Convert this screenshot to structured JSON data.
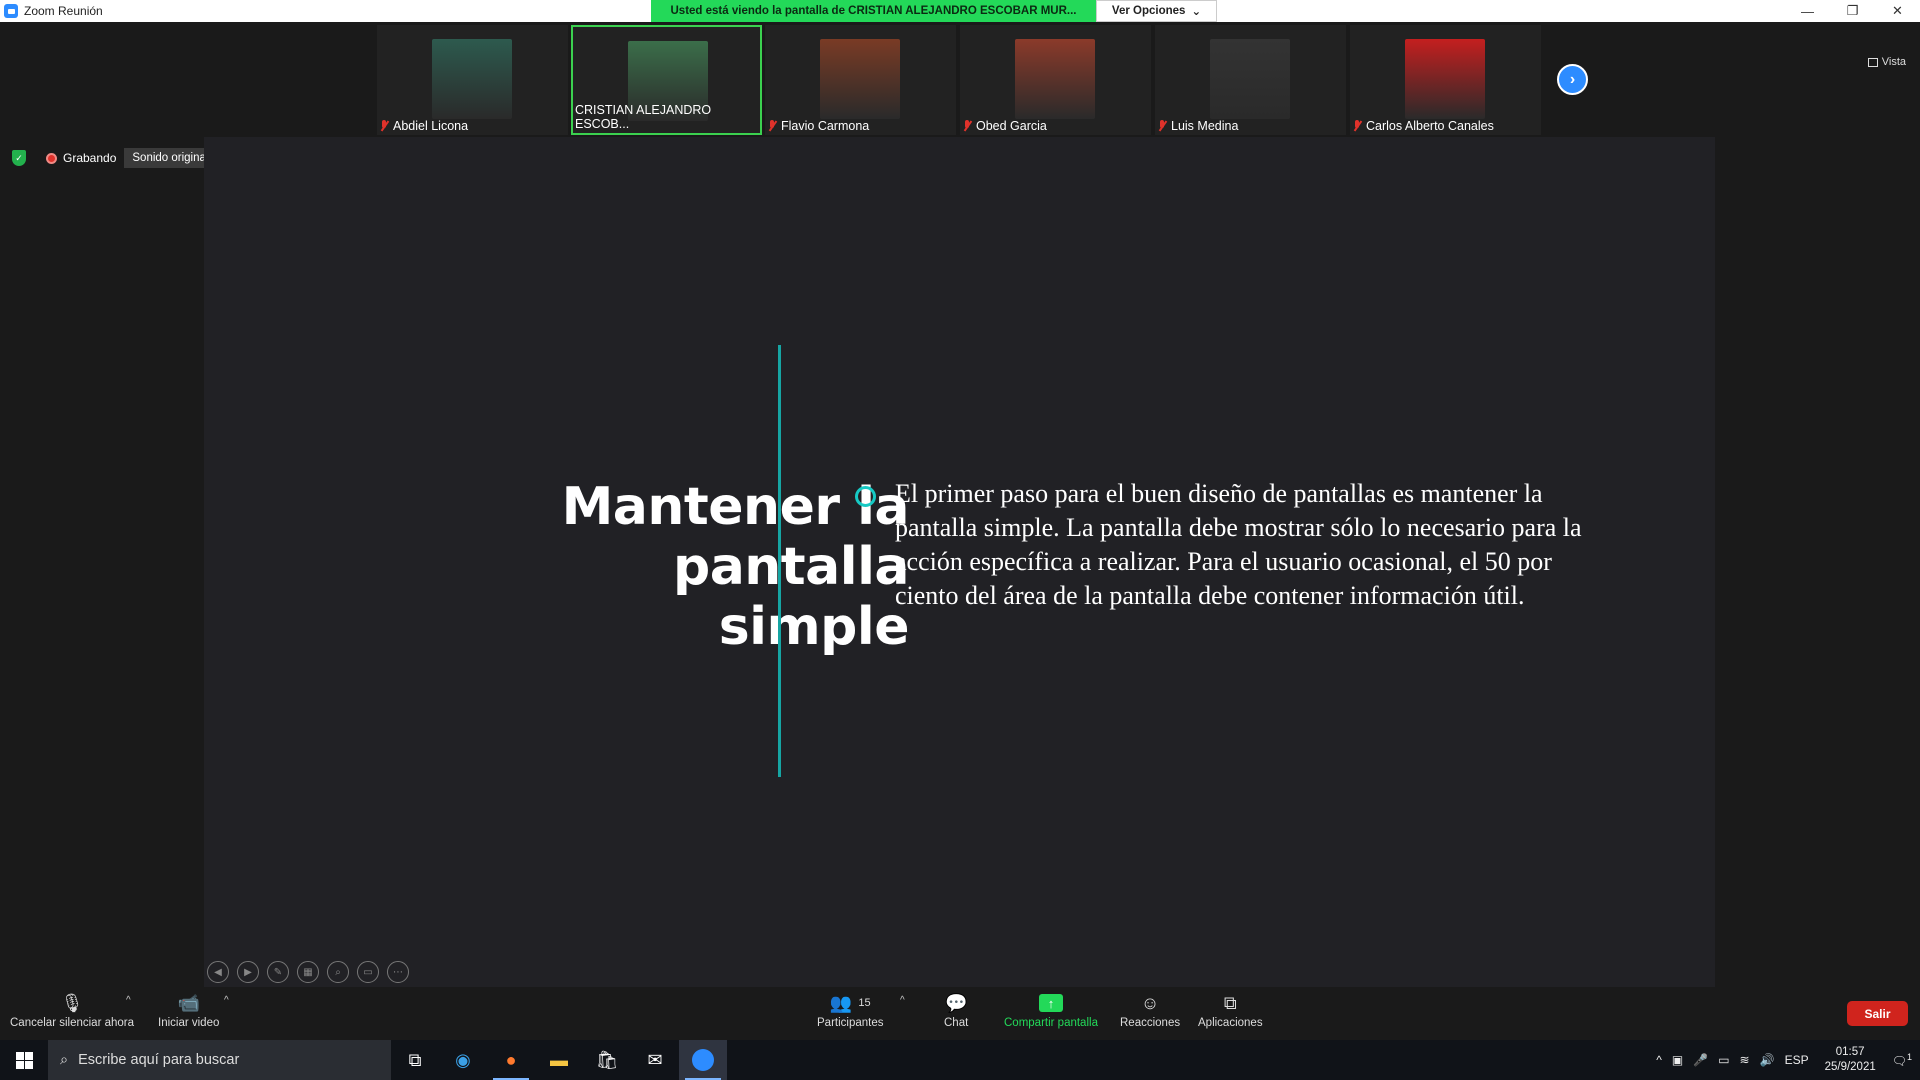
{
  "window": {
    "title": "Zoom Reunión",
    "share_banner": "Usted está viendo la pantalla de CRISTIAN ALEJANDRO ESCOBAR MUR...",
    "view_options": "Ver Opciones"
  },
  "participants_strip": [
    {
      "name": "Abdiel Licona",
      "muted": true,
      "bg": "#2d5a4e"
    },
    {
      "name": "CRISTIAN ALEJANDRO ESCOB...",
      "muted": false,
      "active": true,
      "bg": "#3b6e4a"
    },
    {
      "name": "Flavio Carmona",
      "muted": true,
      "bg": "#7a3b25"
    },
    {
      "name": "Obed Garcia",
      "muted": true,
      "bg": "#8b3a2a"
    },
    {
      "name": "Luis Medina",
      "muted": true,
      "bg": "#333333"
    },
    {
      "name": "Carlos Alberto Canales",
      "muted": true,
      "bg": "#c41f1f"
    }
  ],
  "view_button": "Vista",
  "status": {
    "recording": "Grabando",
    "original_sound": "Sonido original: desactivado"
  },
  "slide": {
    "title_lines": [
      "Mantener la",
      "pantalla",
      "simple"
    ],
    "body": "El primer paso para el buen diseño de pantallas es mantener la pantalla simple. La pantalla debe mostrar sólo lo necesario para la acción específica a realizar. Para el usuario ocasional, el 50 por ciento del área de la pantalla debe contener información útil."
  },
  "toolbar": {
    "unmute": "Cancelar silenciar ahora",
    "start_video": "Iniciar video",
    "participants": "Participantes",
    "participants_count": "15",
    "chat": "Chat",
    "share_screen": "Compartir pantalla",
    "reactions": "Reacciones",
    "apps": "Aplicaciones",
    "leave": "Salir"
  },
  "taskbar": {
    "search_placeholder": "Escribe aquí para buscar",
    "language": "ESP",
    "time": "01:57",
    "date": "25/9/2021",
    "notifications": "1"
  }
}
